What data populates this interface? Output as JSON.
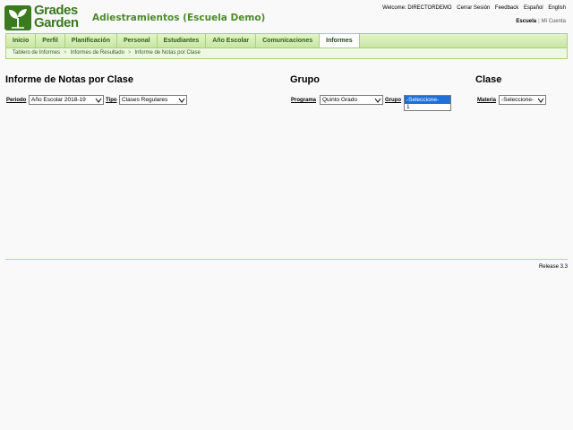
{
  "brand": {
    "line1": "Grades",
    "line2": "Garden",
    "color": "#3b7a1e"
  },
  "site_title": "Adiestramientos (Escuela Demo)",
  "top_links": {
    "welcome": "Welcome: DIRECTORDEMO",
    "logout": "Cerrar Sesión",
    "feedback": "Feedback",
    "spanish": "Español",
    "english": "English"
  },
  "account": {
    "school": "Escuela",
    "my_account": "Mi Cuenta"
  },
  "nav": {
    "items": [
      "Inicio",
      "Perfil",
      "Planificación",
      "Personal",
      "Estudiantes",
      "Año Escolar",
      "Comunicaciones",
      "Informes"
    ],
    "active": "Informes"
  },
  "breadcrumb": [
    "Tablero de Informes",
    "Informes de Resultado",
    "Informe de Notas por Clase"
  ],
  "sections": {
    "report": "Informe de Notas por Clase",
    "group": "Grupo",
    "class": "Clase"
  },
  "filters": {
    "period_label": "Periodo",
    "period_value": "Año Escolar 2018-19",
    "type_label": "Tipo",
    "type_value": "Clases Regulares",
    "program_label": "Programa",
    "program_value": "Quinto Grado",
    "group_label": "Grupo",
    "group_value": "-Seleccione-",
    "group_options": [
      "-Seleccione-",
      "1"
    ],
    "subject_label": "Materia",
    "subject_value": "-Seleccione-"
  },
  "footer": {
    "release": "Release 3.3"
  },
  "colors": {
    "accent": "#4c8b2b",
    "nav_bg": "#c8e6a2",
    "selection": "#1e6fd9"
  }
}
